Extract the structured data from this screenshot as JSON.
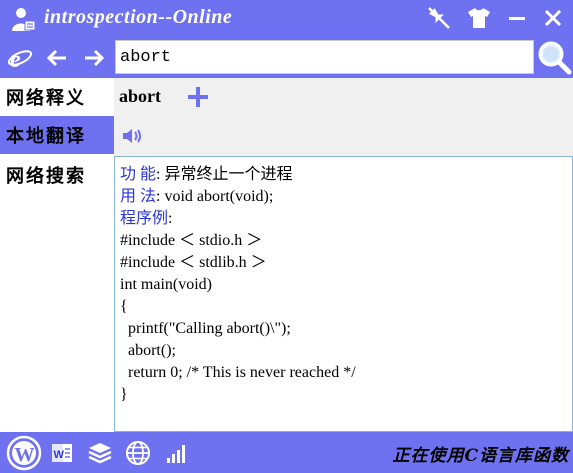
{
  "window": {
    "title": "introspection--Online"
  },
  "search": {
    "value": "abort"
  },
  "sidebar": {
    "items": [
      {
        "label": "网络释义"
      },
      {
        "label": "本地翻译"
      },
      {
        "label": "网络搜索"
      }
    ]
  },
  "word": {
    "text": "abort"
  },
  "content": {
    "lines": [
      {
        "label": "功 能",
        "text": ": 异常终止一个进程"
      },
      {
        "label": "用 法",
        "text": ": void abort(void);"
      },
      {
        "label": "程序例",
        "text": ":"
      },
      {
        "label": "",
        "text": "#include ＜ stdio.h ＞"
      },
      {
        "label": "",
        "text": "#include ＜ stdlib.h ＞"
      },
      {
        "label": "",
        "text": "int main(void)"
      },
      {
        "label": "",
        "text": "{"
      },
      {
        "label": "",
        "text": "  printf(\"Calling abort()\\\");"
      },
      {
        "label": "",
        "text": "  abort();"
      },
      {
        "label": "",
        "text": "  return 0; /* This is never reached */"
      },
      {
        "label": "",
        "text": "}"
      }
    ]
  },
  "status": {
    "text": "正在使用C语言库函数"
  },
  "colors": {
    "accent": "#6f72f0",
    "label": "#2a35d6",
    "panel": "#f0f0f0"
  },
  "icons": {
    "title": "user-icon",
    "titlebar": [
      "pin-icon",
      "shirt-icon",
      "minimize-icon",
      "close-icon"
    ],
    "nav": [
      "browser-icon",
      "back-icon",
      "forward-icon"
    ],
    "search": "search-icon",
    "bottom": [
      "wordpress-icon",
      "word-icon",
      "layers-icon",
      "globe-icon",
      "signal-icon"
    ]
  }
}
